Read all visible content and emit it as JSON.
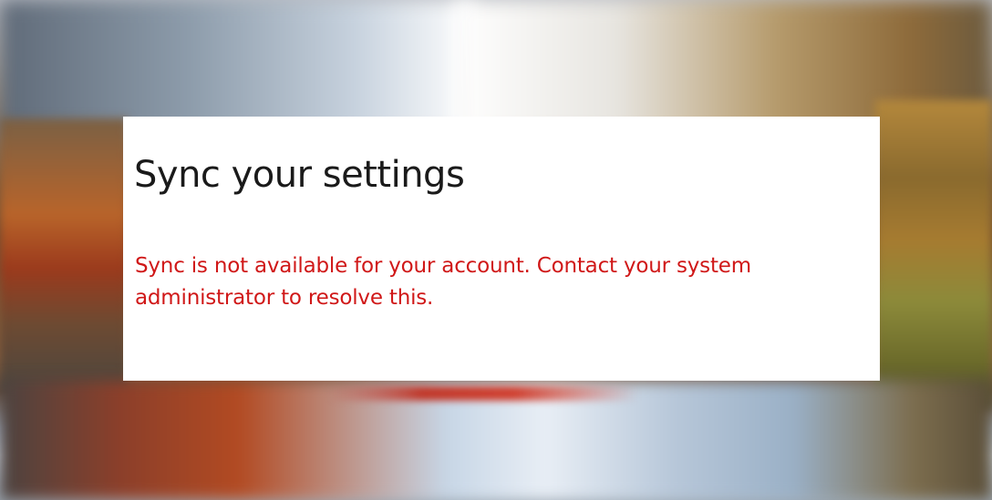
{
  "panel": {
    "title": "Sync your settings",
    "message_lines": [
      "Sync is not available for your account. Contact your system",
      "administrator to resolve this."
    ]
  },
  "colors": {
    "panel_background": "#ffffff",
    "title_text": "#1a1a1a",
    "error_text": "#d01818"
  }
}
